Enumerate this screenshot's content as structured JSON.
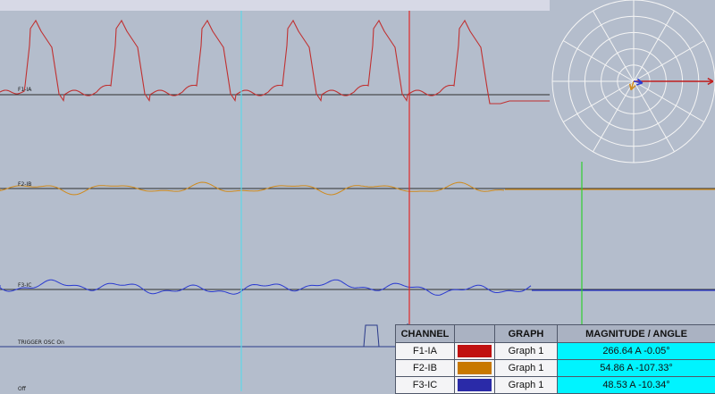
{
  "window": {
    "background": "#b4bdcc",
    "title_bar_color": "#d7d9e6"
  },
  "channels": [
    {
      "id": "ia",
      "label": "F1-IA",
      "color": "#c03030",
      "baseline_color": "#2e2e2e"
    },
    {
      "id": "ib",
      "label": "F2-IB",
      "color": "#d08a1a",
      "baseline_color": "#2e2e2e"
    },
    {
      "id": "ic",
      "label": "F3-IC",
      "color": "#2a3ad0",
      "baseline_color": "#2e2e2e"
    }
  ],
  "trigger": {
    "label": "TRIGGER OSC  On"
  },
  "bottom_label": {
    "label": "Off"
  },
  "cursors": {
    "cursor1_color": "#5fd8e8",
    "cursor2_color": "#e02828",
    "cursor3_color": "#30d030"
  },
  "phasor": {
    "circle_color": "#f5f5f5",
    "ref_arrow_color": "#c02020",
    "phasors": [
      {
        "name": "F1-IA",
        "magnitude": 266.64,
        "angle_deg": -0.05,
        "color": "#c02020"
      },
      {
        "name": "F2-IB",
        "magnitude": 54.86,
        "angle_deg": -107.33,
        "color": "#d08a1a"
      },
      {
        "name": "F3-IC",
        "magnitude": 48.53,
        "angle_deg": -10.34,
        "color": "#2a3ad0"
      }
    ]
  },
  "legend": {
    "headers": {
      "channel": "CHANNEL",
      "swatch": "",
      "graph": "GRAPH",
      "magnitude": "MAGNITUDE / ANGLE"
    },
    "rows": [
      {
        "channel": "F1-IA",
        "color": "#c01010",
        "graph": "Graph 1",
        "magnitude": "266.64 A  -0.05°"
      },
      {
        "channel": "F2-IB",
        "color": "#c87800",
        "graph": "Graph 1",
        "magnitude": "54.86 A  -107.33°"
      },
      {
        "channel": "F3-IC",
        "color": "#2a2aa8",
        "graph": "Graph 1",
        "magnitude": "48.53 A  -10.34°"
      }
    ]
  }
}
